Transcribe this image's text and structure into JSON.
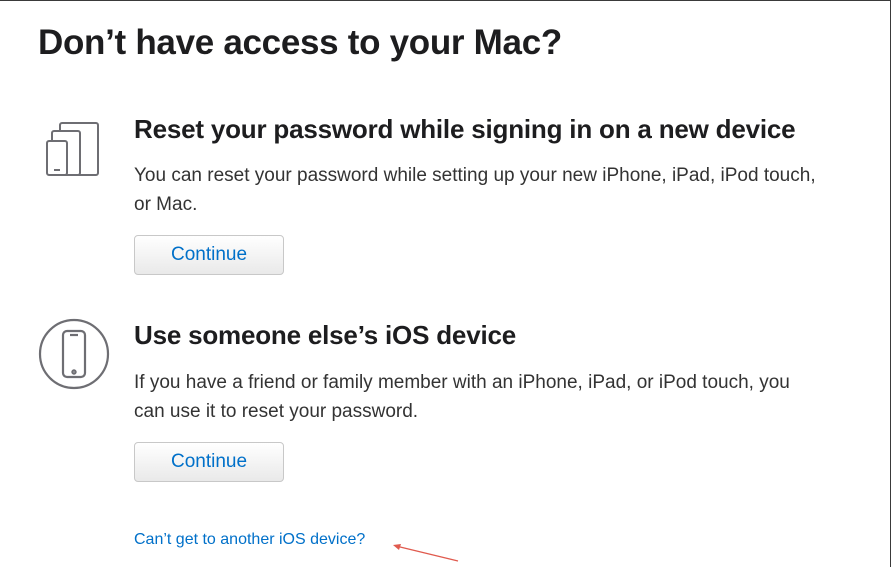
{
  "page": {
    "title": "Don’t have access to your Mac?"
  },
  "options": [
    {
      "heading": "Reset your password while signing in on a new device",
      "description": "You can reset your password while setting up your new iPhone, iPad, iPod touch, or Mac.",
      "button_label": "Continue",
      "icon": "devices-icon"
    },
    {
      "heading": "Use someone else’s iOS device",
      "description": "If you have a friend or family member with an iPhone, iPad, or iPod touch, you can use it to reset your password.",
      "button_label": "Continue",
      "icon": "iphone-circle-icon"
    }
  ],
  "help_link": {
    "label": "Can’t get to another iOS device?"
  },
  "colors": {
    "link": "#0070c9",
    "heading": "#1d1d1f",
    "body_text": "#333333",
    "icon_gray": "#6e6e73",
    "annotation_arrow": "#e05a4e"
  }
}
